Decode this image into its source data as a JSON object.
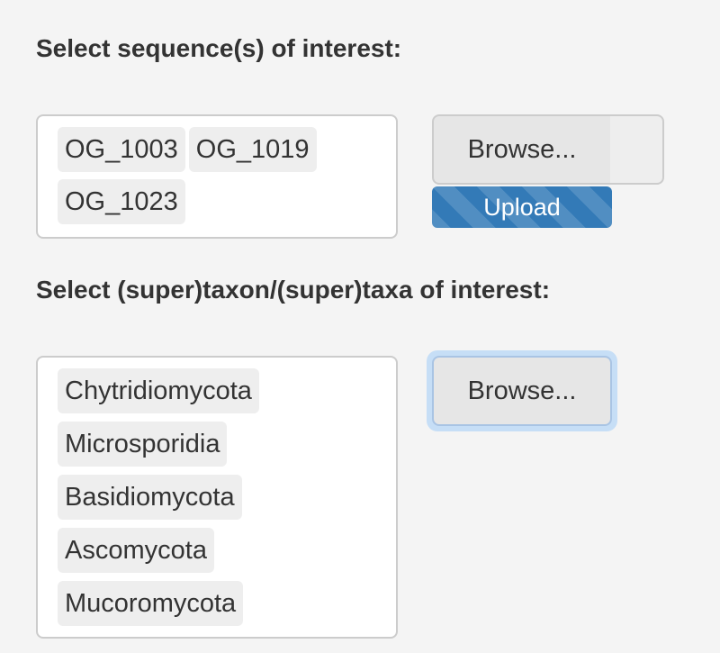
{
  "sequence_section": {
    "heading": "Select sequence(s) of interest:",
    "selected": [
      "OG_1003",
      "OG_1019",
      "OG_1023"
    ],
    "browse_label": "Browse...",
    "file_name": "",
    "progress_label": "Upload",
    "progress_fraction": 1.0
  },
  "taxon_section": {
    "heading": "Select (super)taxon/(super)taxa of interest:",
    "selected": [
      "Chytridiomycota",
      "Microsporidia",
      "Basidiomycota",
      "Ascomycota",
      "Mucoromycota"
    ],
    "browse_label": "Browse..."
  },
  "colors": {
    "progress_bar": "#337ab7",
    "focus_ring": "#c6def6",
    "tag_background": "#eeeeee"
  }
}
